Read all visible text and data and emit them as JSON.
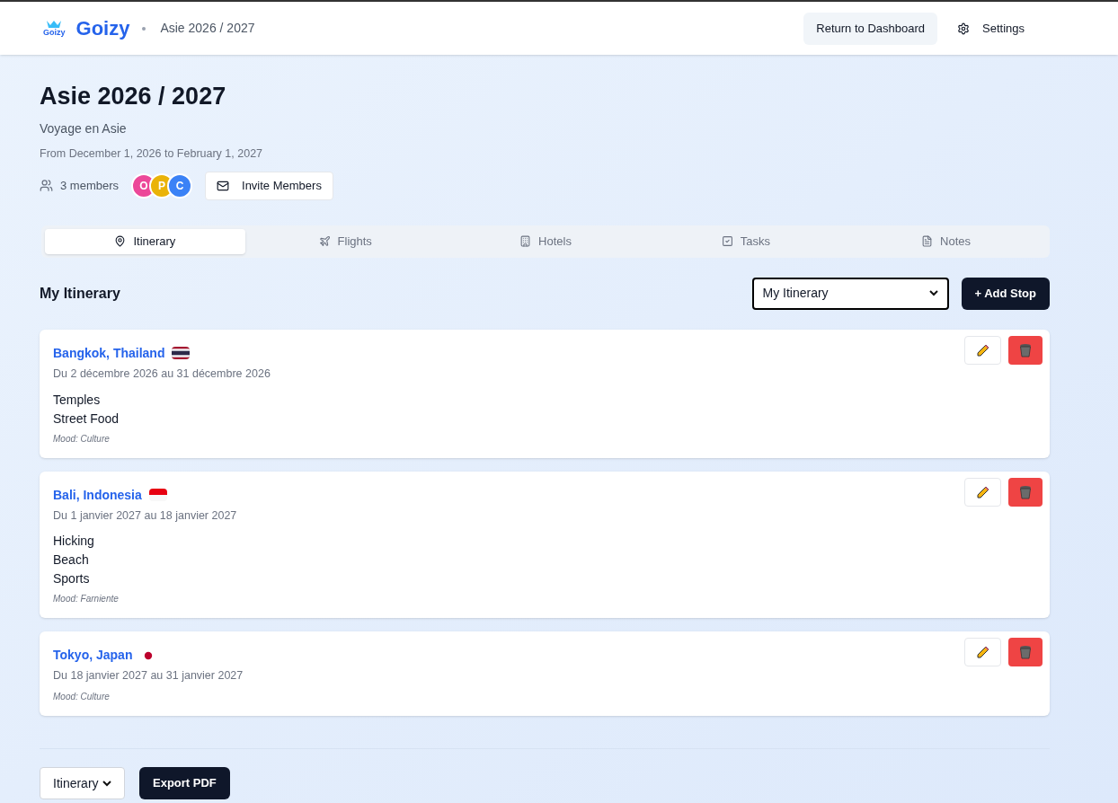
{
  "header": {
    "logo_text": "Goizy",
    "brand": "Goizy",
    "breadcrumb": "Asie 2026 / 2027",
    "buttons": [
      {
        "kind": "dashboard",
        "label": "Return to Dashboard"
      },
      {
        "kind": "settings",
        "label": "Settings"
      }
    ]
  },
  "trip": {
    "title": "Asie 2026 / 2027",
    "subtitle": "Voyage en Asie",
    "dates": "From December 1, 2026 to February 1, 2027",
    "members_count": "3 members",
    "members": [
      {
        "initial": "O",
        "color": "#ec4899"
      },
      {
        "initial": "P",
        "color": "#eab308"
      },
      {
        "initial": "C",
        "color": "#3b82f6"
      }
    ],
    "invite": "Invite Members"
  },
  "tabs": [
    {
      "label": "Itinerary",
      "selected": true
    },
    {
      "label": "Flights",
      "selected": false
    },
    {
      "label": "Hotels",
      "selected": false
    },
    {
      "label": "Tasks",
      "selected": false
    },
    {
      "label": "Notes",
      "selected": false
    }
  ],
  "itinerary": {
    "heading": "My Itinerary",
    "select_value": "My Itinerary",
    "add_button": "+ Add Stop",
    "stops": [
      {
        "place": "Bangkok, Thailand",
        "dates": "Du 2 décembre 2026 au 31 décembre 2026",
        "activities": [
          "Temples",
          "Street Food"
        ],
        "mood": "Mood: Culture"
      },
      {
        "place": "Bali, Indonesia",
        "dates": "Du 1 janvier 2027 au 18 janvier 2027",
        "activities": [
          "Hicking",
          "Beach",
          "Sports"
        ],
        "mood": "Mood: Farniente"
      },
      {
        "place": "Tokyo, Japan",
        "dates": "Du 18 janvier 2027 au 31 janvier 2027",
        "mood": "Mood: Culture"
      }
    ]
  },
  "footer": {
    "select_value": "Itinerary",
    "export_button": "Export PDF"
  }
}
